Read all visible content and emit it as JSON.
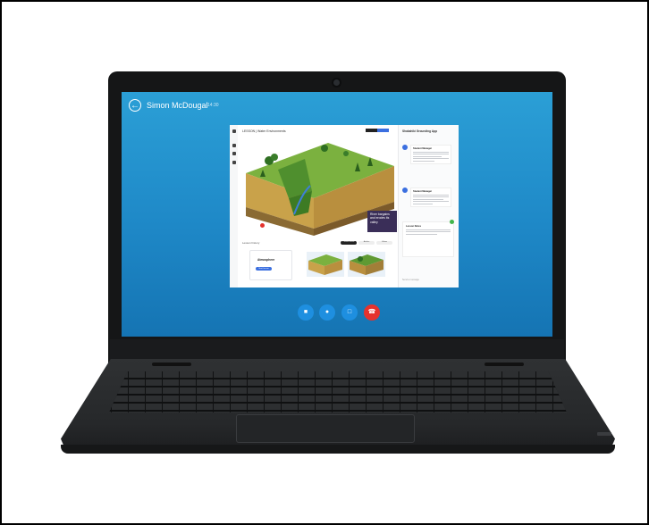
{
  "call": {
    "caller_name": "Simon McDougal",
    "duration": "14:30",
    "back_icon": "arrow-left-icon"
  },
  "app": {
    "title": "LESSON | Water Environments",
    "caption": "River bargains and erodes its valley",
    "lesson_section": "Lesson history",
    "tabs": [
      "Current lesson",
      "Articles",
      "Videos"
    ],
    "card_title": "Atmosphere",
    "card_button": "Start lesson",
    "panel": {
      "title": "Shakahiki Grounding App",
      "messages": [
        {
          "name": "Student Manager"
        },
        {
          "name": "Student Manager"
        }
      ],
      "note_title": "Lesson Notes",
      "input_placeholder": "Send a message"
    }
  },
  "call_bar": [
    {
      "icon": "video-camera-icon",
      "color": "#1e8fe0"
    },
    {
      "icon": "microphone-icon",
      "color": "#1e8fe0"
    },
    {
      "icon": "chat-icon",
      "color": "#1e8fe0"
    },
    {
      "icon": "end-call-icon",
      "color": "#e5322d"
    }
  ]
}
